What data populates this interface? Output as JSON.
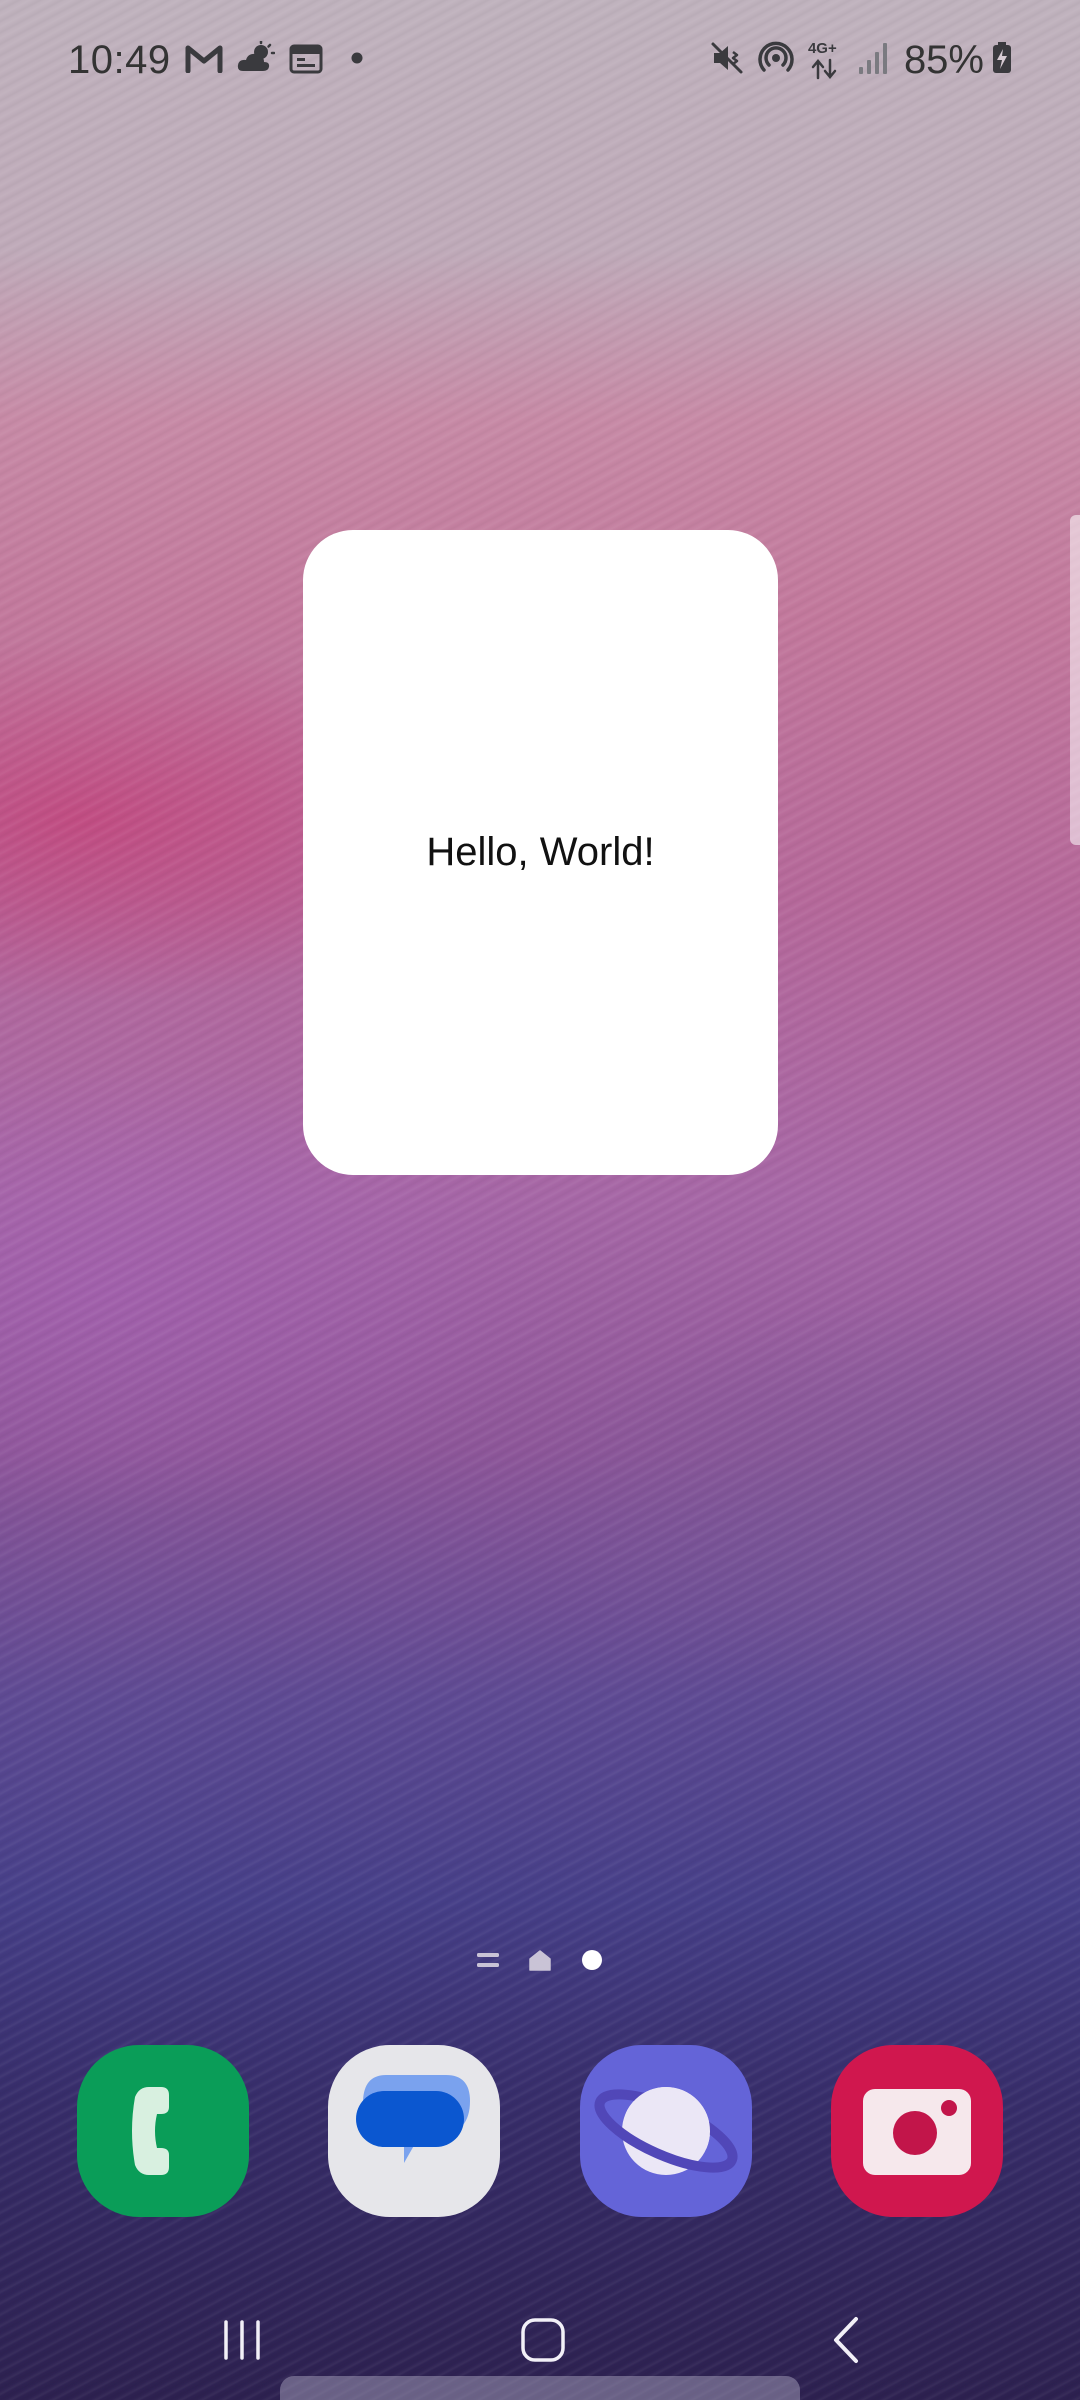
{
  "status_bar": {
    "time": "10:49",
    "left_icons": [
      "gmail-icon",
      "weather-partly-cloudy-icon",
      "calendar-icon",
      "notification-dot-icon"
    ],
    "right_icons": [
      "vibrate-mute-icon",
      "hotspot-icon",
      "network-4g-plus-icon",
      "signal-icon"
    ],
    "network_label": "4G+",
    "battery_percent": "85%",
    "battery_level": 0.85,
    "battery_charging": true
  },
  "widget": {
    "text": "Hello, World!"
  },
  "page_indicator": {
    "items": [
      "feed-page",
      "home-page",
      "current-page"
    ],
    "active_index": 2
  },
  "dock": {
    "apps": [
      {
        "name": "Phone",
        "icon": "phone-icon",
        "color": "#0a9d58"
      },
      {
        "name": "Messages",
        "icon": "messages-icon",
        "color": "#e6e6ea"
      },
      {
        "name": "Internet",
        "icon": "internet-icon",
        "color": "#6464d8"
      },
      {
        "name": "Camera",
        "icon": "camera-icon",
        "color": "#d0174e"
      }
    ]
  },
  "nav_bar": {
    "buttons": [
      "recents",
      "home",
      "back"
    ]
  },
  "colors": {
    "widget_bg": "#ffffff",
    "text_dark": "#333333"
  }
}
